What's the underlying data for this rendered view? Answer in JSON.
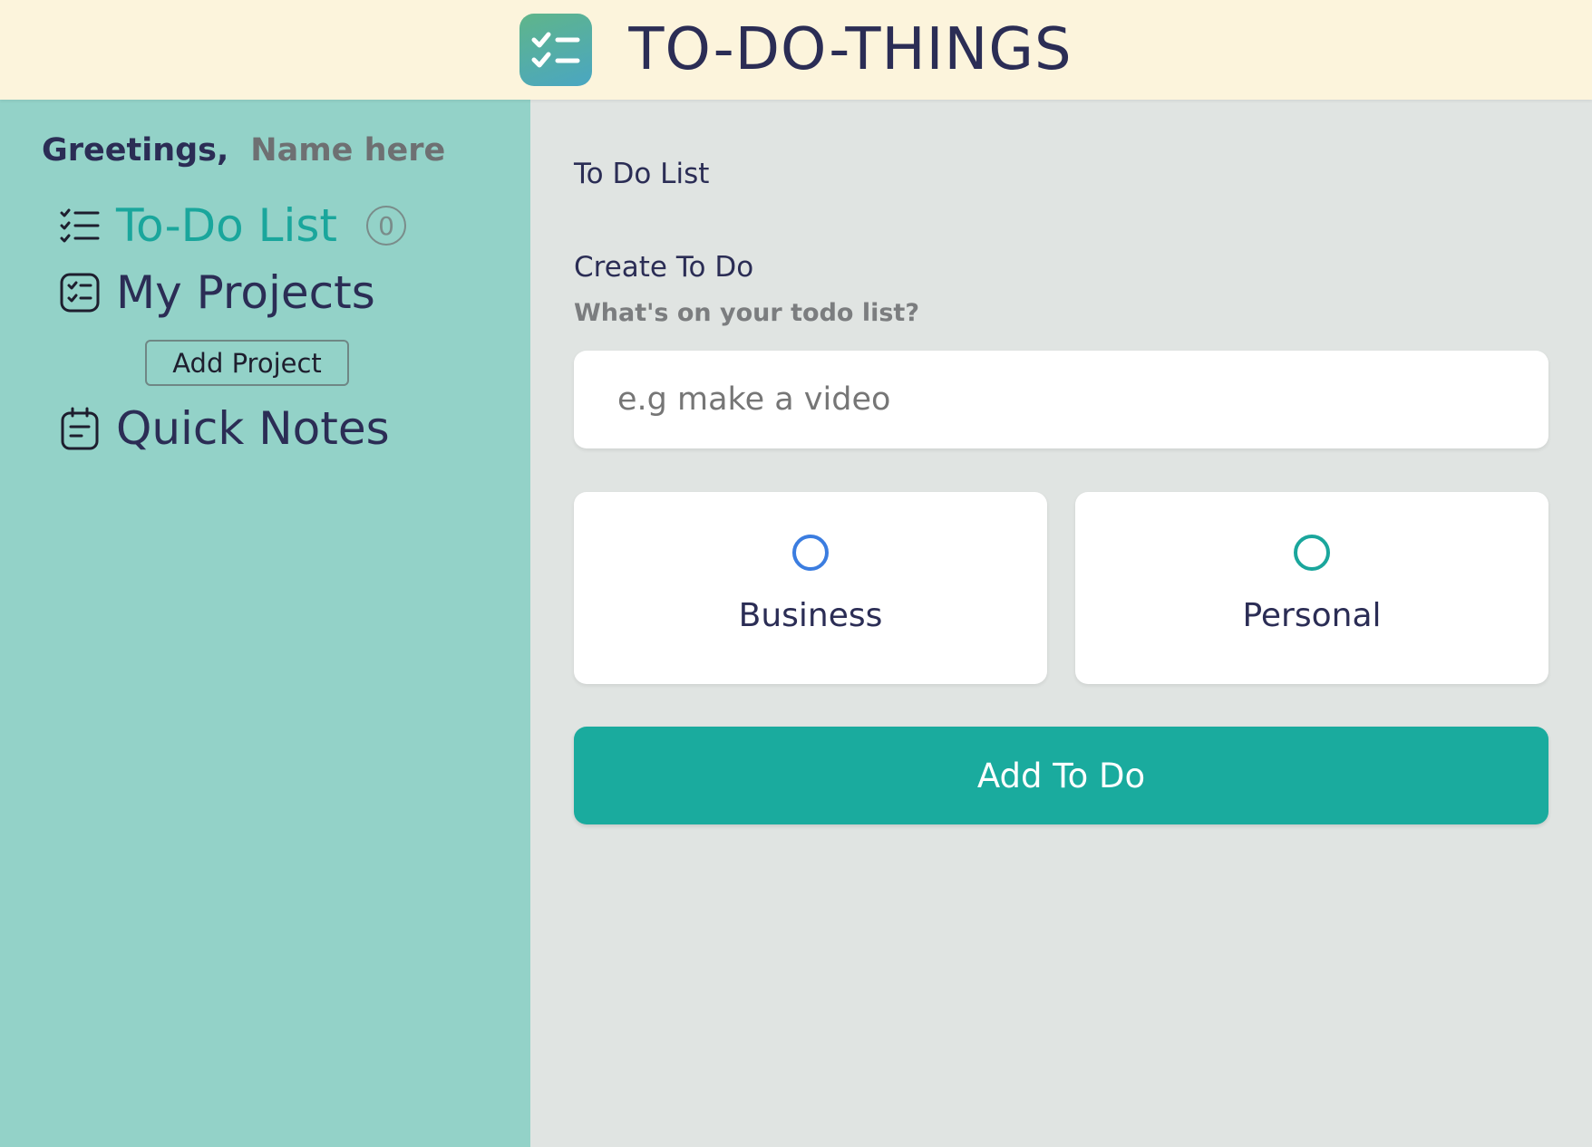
{
  "header": {
    "app_title": "TO-DO-THINGS",
    "logo_icon": "checklist-icon"
  },
  "colors": {
    "header_bg": "#fcf4dc",
    "sidebar_bg": "#93d2c8",
    "main_bg": "#e0e4e2",
    "accent": "#1aab9e",
    "text": "#2b2d55",
    "business_radio": "#3b7de0",
    "personal_radio": "#1aa69c"
  },
  "sidebar": {
    "greeting_label": "Greetings,",
    "user_name": "Name here",
    "items": [
      {
        "label": "To-Do List",
        "icon": "list-check-icon",
        "count": "0",
        "active": true
      },
      {
        "label": "My Projects",
        "icon": "checklist-square-icon"
      },
      {
        "label": "Quick Notes",
        "icon": "notepad-icon"
      }
    ],
    "add_project_label": "Add Project"
  },
  "main": {
    "section_title": "To Do List",
    "create_title": "Create To Do",
    "create_subtitle": "What's on your todo list?",
    "input": {
      "placeholder": "e.g make a video",
      "value": ""
    },
    "options": [
      {
        "label": "Business",
        "selected": false
      },
      {
        "label": "Personal",
        "selected": false
      }
    ],
    "submit_label": "Add To Do"
  }
}
